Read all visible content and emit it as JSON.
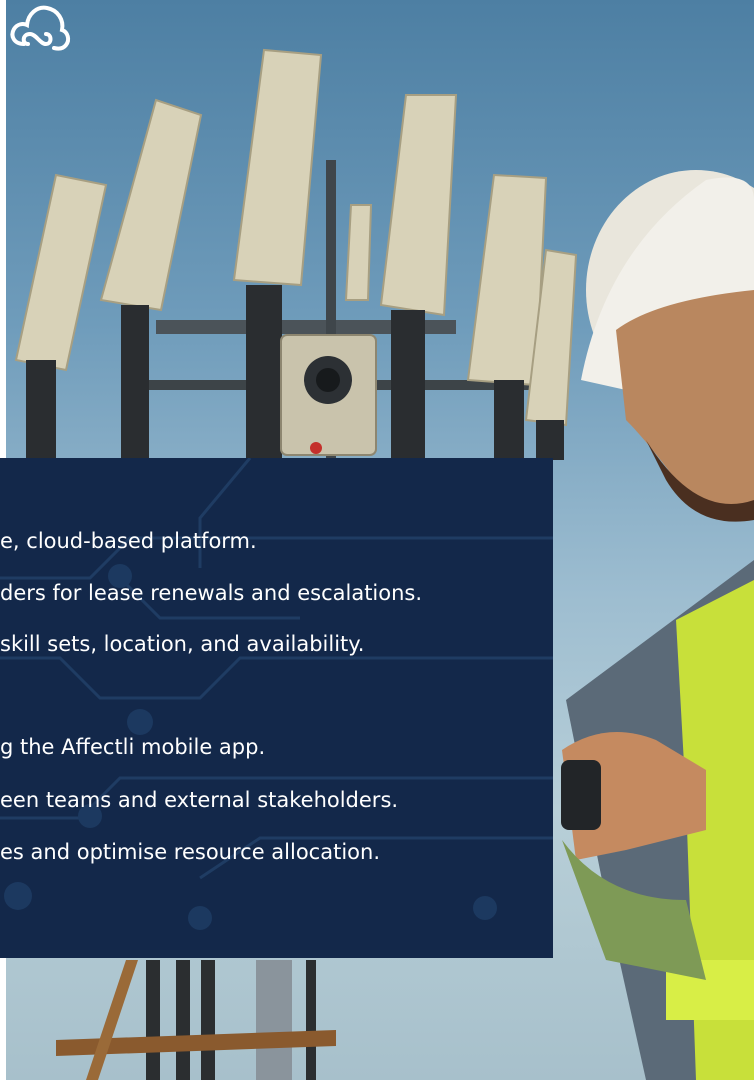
{
  "brand": {
    "logo_icon": "cloud-link-icon",
    "logo_color": "#ffffff"
  },
  "panel": {
    "background_color": "#13284a",
    "text_color": "#ffffff",
    "lines": [
      "e, cloud-based platform.",
      "ders for lease renewals and escalations.",
      "skill sets, location, and availability.",
      "g the Affectli mobile app.",
      "een teams and external stakeholders.",
      "es and optimise resource allocation."
    ]
  },
  "photo": {
    "subject": "telecom-tower-worker-photo"
  }
}
